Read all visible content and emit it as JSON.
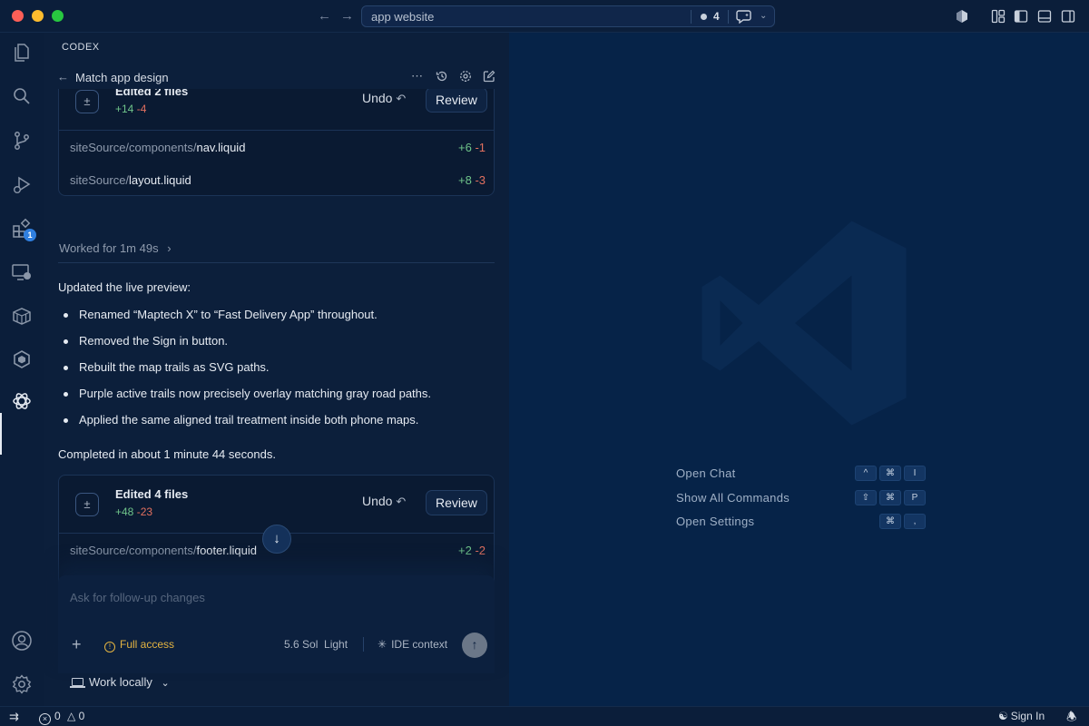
{
  "window": {
    "command_center_text": "app website",
    "count": "4"
  },
  "activity_bar": {
    "extensions_badge": "1"
  },
  "panel": {
    "title": "CODEX",
    "thread_title": "Match app design",
    "card1": {
      "title": "Edited 2 files",
      "added": "+14",
      "removed": "-4",
      "undo": "Undo",
      "review": "Review",
      "files": [
        {
          "dir": "siteSource/components/",
          "name": "nav.liquid",
          "added": "+6",
          "removed": "-1"
        },
        {
          "dir": "siteSource/",
          "name": "layout.liquid",
          "added": "+8",
          "removed": "-3"
        }
      ]
    },
    "worked_for": "Worked for 1m 49s",
    "summary": "Updated the live preview:",
    "bullets": [
      "Renamed “Maptech X” to “Fast Delivery App” throughout.",
      "Removed the Sign in button.",
      "Rebuilt the map trails as SVG paths.",
      "Purple active trails now precisely overlay matching gray road paths.",
      "Applied the same aligned trail treatment inside both phone maps."
    ],
    "completed": "Completed in about 1 minute 44 seconds.",
    "card2": {
      "title": "Edited 4 files",
      "added": "+48",
      "removed": "-23",
      "undo": "Undo",
      "review": "Review",
      "files": [
        {
          "dir": "siteSource/components/",
          "name": "footer.liquid",
          "added": "+2",
          "removed": "-2"
        }
      ]
    },
    "composer": {
      "placeholder": "Ask for follow-up changes",
      "access": "Full access",
      "model": "5.6 Sol  Light",
      "ide_context": "IDE context"
    },
    "work_mode": "Work locally"
  },
  "editor": {
    "shortcuts": [
      {
        "label": "Open Chat",
        "keys": [
          "^",
          "⌘",
          "I"
        ]
      },
      {
        "label": "Show All Commands",
        "keys": [
          "⇧",
          "⌘",
          "P"
        ]
      },
      {
        "label": "Open Settings",
        "keys": [
          "⌘",
          ","
        ]
      }
    ]
  },
  "statusbar": {
    "errors": "0",
    "warnings": "0",
    "sign_in": "Sign In"
  }
}
